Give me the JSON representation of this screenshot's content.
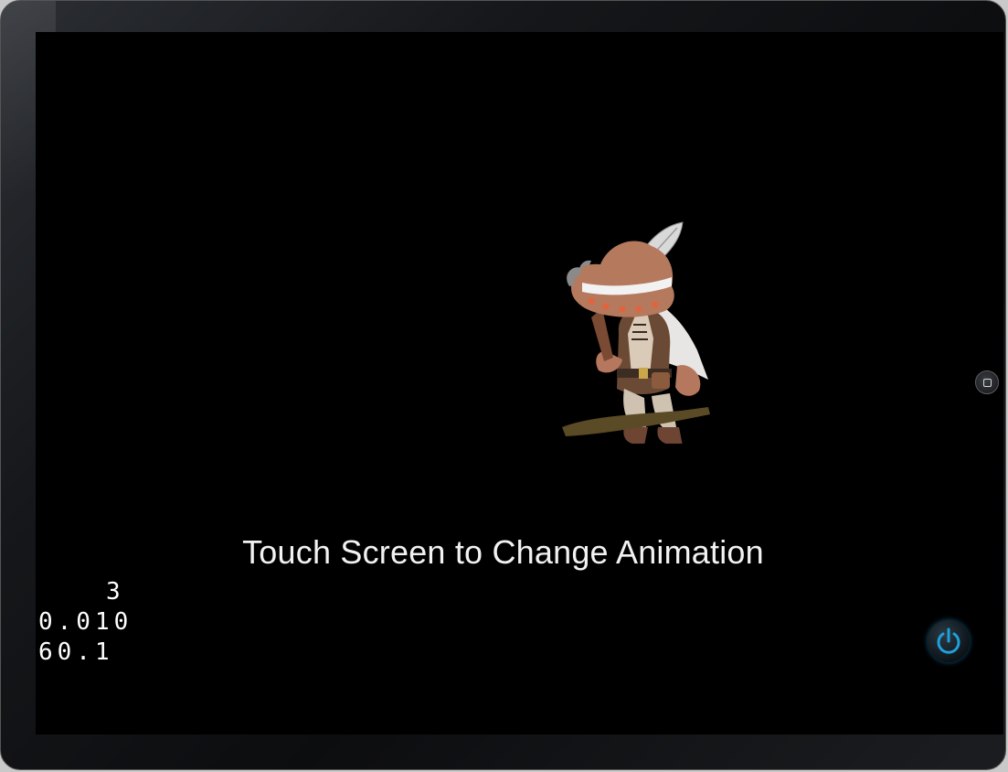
{
  "game": {
    "prompt_text": "Touch Screen to Change Animation",
    "stats": {
      "line1": "3",
      "line2": "0.010",
      "line3": "60.1"
    },
    "character_icon": "musketeer-character-sprite",
    "colors": {
      "background": "#000000",
      "text": "#f2f2f2",
      "power_accent": "#1ea0dc"
    }
  },
  "device": {
    "home_icon": "home-button-icon",
    "power_icon": "power-icon"
  }
}
